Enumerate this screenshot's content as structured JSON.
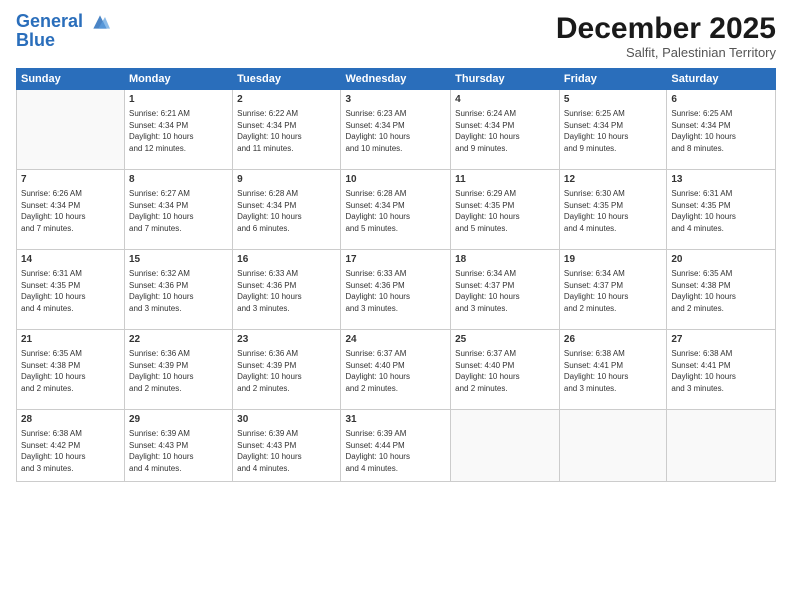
{
  "logo": {
    "line1": "General",
    "line2": "Blue"
  },
  "title": "December 2025",
  "subtitle": "Salfit, Palestinian Territory",
  "columns": [
    "Sunday",
    "Monday",
    "Tuesday",
    "Wednesday",
    "Thursday",
    "Friday",
    "Saturday"
  ],
  "weeks": [
    [
      {
        "day": "",
        "info": ""
      },
      {
        "day": "1",
        "info": "Sunrise: 6:21 AM\nSunset: 4:34 PM\nDaylight: 10 hours\nand 12 minutes."
      },
      {
        "day": "2",
        "info": "Sunrise: 6:22 AM\nSunset: 4:34 PM\nDaylight: 10 hours\nand 11 minutes."
      },
      {
        "day": "3",
        "info": "Sunrise: 6:23 AM\nSunset: 4:34 PM\nDaylight: 10 hours\nand 10 minutes."
      },
      {
        "day": "4",
        "info": "Sunrise: 6:24 AM\nSunset: 4:34 PM\nDaylight: 10 hours\nand 9 minutes."
      },
      {
        "day": "5",
        "info": "Sunrise: 6:25 AM\nSunset: 4:34 PM\nDaylight: 10 hours\nand 9 minutes."
      },
      {
        "day": "6",
        "info": "Sunrise: 6:25 AM\nSunset: 4:34 PM\nDaylight: 10 hours\nand 8 minutes."
      }
    ],
    [
      {
        "day": "7",
        "info": "Sunrise: 6:26 AM\nSunset: 4:34 PM\nDaylight: 10 hours\nand 7 minutes."
      },
      {
        "day": "8",
        "info": "Sunrise: 6:27 AM\nSunset: 4:34 PM\nDaylight: 10 hours\nand 7 minutes."
      },
      {
        "day": "9",
        "info": "Sunrise: 6:28 AM\nSunset: 4:34 PM\nDaylight: 10 hours\nand 6 minutes."
      },
      {
        "day": "10",
        "info": "Sunrise: 6:28 AM\nSunset: 4:34 PM\nDaylight: 10 hours\nand 5 minutes."
      },
      {
        "day": "11",
        "info": "Sunrise: 6:29 AM\nSunset: 4:35 PM\nDaylight: 10 hours\nand 5 minutes."
      },
      {
        "day": "12",
        "info": "Sunrise: 6:30 AM\nSunset: 4:35 PM\nDaylight: 10 hours\nand 4 minutes."
      },
      {
        "day": "13",
        "info": "Sunrise: 6:31 AM\nSunset: 4:35 PM\nDaylight: 10 hours\nand 4 minutes."
      }
    ],
    [
      {
        "day": "14",
        "info": "Sunrise: 6:31 AM\nSunset: 4:35 PM\nDaylight: 10 hours\nand 4 minutes."
      },
      {
        "day": "15",
        "info": "Sunrise: 6:32 AM\nSunset: 4:36 PM\nDaylight: 10 hours\nand 3 minutes."
      },
      {
        "day": "16",
        "info": "Sunrise: 6:33 AM\nSunset: 4:36 PM\nDaylight: 10 hours\nand 3 minutes."
      },
      {
        "day": "17",
        "info": "Sunrise: 6:33 AM\nSunset: 4:36 PM\nDaylight: 10 hours\nand 3 minutes."
      },
      {
        "day": "18",
        "info": "Sunrise: 6:34 AM\nSunset: 4:37 PM\nDaylight: 10 hours\nand 3 minutes."
      },
      {
        "day": "19",
        "info": "Sunrise: 6:34 AM\nSunset: 4:37 PM\nDaylight: 10 hours\nand 2 minutes."
      },
      {
        "day": "20",
        "info": "Sunrise: 6:35 AM\nSunset: 4:38 PM\nDaylight: 10 hours\nand 2 minutes."
      }
    ],
    [
      {
        "day": "21",
        "info": "Sunrise: 6:35 AM\nSunset: 4:38 PM\nDaylight: 10 hours\nand 2 minutes."
      },
      {
        "day": "22",
        "info": "Sunrise: 6:36 AM\nSunset: 4:39 PM\nDaylight: 10 hours\nand 2 minutes."
      },
      {
        "day": "23",
        "info": "Sunrise: 6:36 AM\nSunset: 4:39 PM\nDaylight: 10 hours\nand 2 minutes."
      },
      {
        "day": "24",
        "info": "Sunrise: 6:37 AM\nSunset: 4:40 PM\nDaylight: 10 hours\nand 2 minutes."
      },
      {
        "day": "25",
        "info": "Sunrise: 6:37 AM\nSunset: 4:40 PM\nDaylight: 10 hours\nand 2 minutes."
      },
      {
        "day": "26",
        "info": "Sunrise: 6:38 AM\nSunset: 4:41 PM\nDaylight: 10 hours\nand 3 minutes."
      },
      {
        "day": "27",
        "info": "Sunrise: 6:38 AM\nSunset: 4:41 PM\nDaylight: 10 hours\nand 3 minutes."
      }
    ],
    [
      {
        "day": "28",
        "info": "Sunrise: 6:38 AM\nSunset: 4:42 PM\nDaylight: 10 hours\nand 3 minutes."
      },
      {
        "day": "29",
        "info": "Sunrise: 6:39 AM\nSunset: 4:43 PM\nDaylight: 10 hours\nand 4 minutes."
      },
      {
        "day": "30",
        "info": "Sunrise: 6:39 AM\nSunset: 4:43 PM\nDaylight: 10 hours\nand 4 minutes."
      },
      {
        "day": "31",
        "info": "Sunrise: 6:39 AM\nSunset: 4:44 PM\nDaylight: 10 hours\nand 4 minutes."
      },
      {
        "day": "",
        "info": ""
      },
      {
        "day": "",
        "info": ""
      },
      {
        "day": "",
        "info": ""
      }
    ]
  ]
}
